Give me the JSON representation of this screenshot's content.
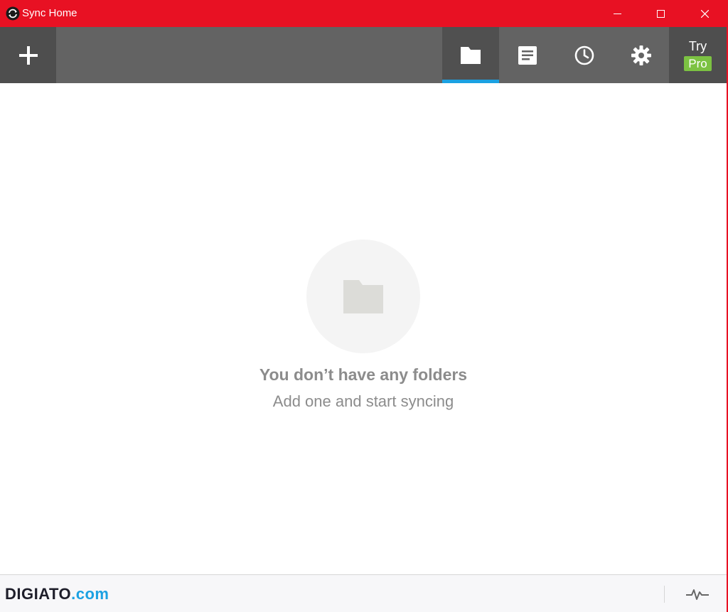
{
  "window": {
    "title": "Sync Home"
  },
  "titlebar_buttons": {
    "minimize": "minimize-icon",
    "maximize": "maximize-icon",
    "close": "close-icon"
  },
  "toolbar": {
    "add_icon": "plus-icon",
    "tabs": [
      {
        "id": "folders",
        "icon": "folder-icon",
        "active": true
      },
      {
        "id": "log",
        "icon": "document-icon",
        "active": false
      },
      {
        "id": "history",
        "icon": "clock-icon",
        "active": false
      },
      {
        "id": "settings",
        "icon": "gear-icon",
        "active": false
      }
    ],
    "try_label": "Try",
    "pro_label": "Pro"
  },
  "empty_state": {
    "icon": "folder-icon",
    "title": "You don’t have any folders",
    "subtitle": "Add one and start syncing"
  },
  "statusbar": {
    "watermark_main": "DIGIATO",
    "watermark_tld": ".com",
    "activity_icon": "activity-icon"
  },
  "colors": {
    "titlebar": "#e81123",
    "toolbar": "#636363",
    "toolbar_dark": "#4e4e4e",
    "accent_blue": "#1ba1e2",
    "pro_green": "#7cc242",
    "empty_text": "#8c8c8c"
  }
}
